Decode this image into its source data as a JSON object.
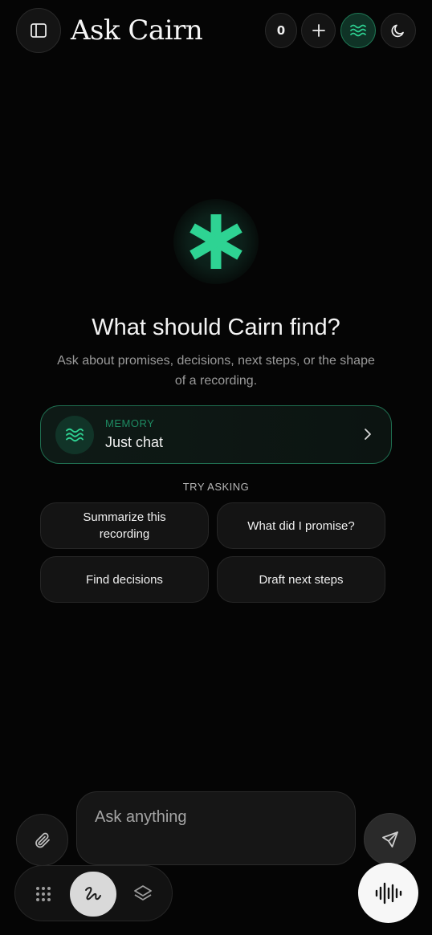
{
  "header": {
    "title": "Ask Cairn",
    "count": "0"
  },
  "hero": {
    "headline": "What should Cairn find?",
    "subline": "Ask about promises, decisions, next steps, or the shape of a recording."
  },
  "memory": {
    "kicker": "MEMORY",
    "value": "Just chat"
  },
  "suggestions": {
    "label": "TRY ASKING",
    "items": [
      "Summarize this recording",
      "What did I promise?",
      "Find decisions",
      "Draft next steps"
    ]
  },
  "composer": {
    "placeholder": "Ask anything"
  },
  "icons": {
    "sidebar_toggle": "sidebar-panel-icon",
    "new_chat": "plus-icon",
    "memory_waves": "waves-icon",
    "theme": "moon-icon",
    "hero": "asterisk-icon",
    "chevron": "chevron-right-icon",
    "attach": "paperclip-icon",
    "send": "send-icon",
    "apps": "grid-icon",
    "ink": "scribble-icon",
    "layers": "layers-icon",
    "voice": "waveform-icon"
  },
  "colors": {
    "background": "#050505",
    "accent": "#2ed393",
    "accent_dark": "#113428",
    "surface": "#141414"
  }
}
